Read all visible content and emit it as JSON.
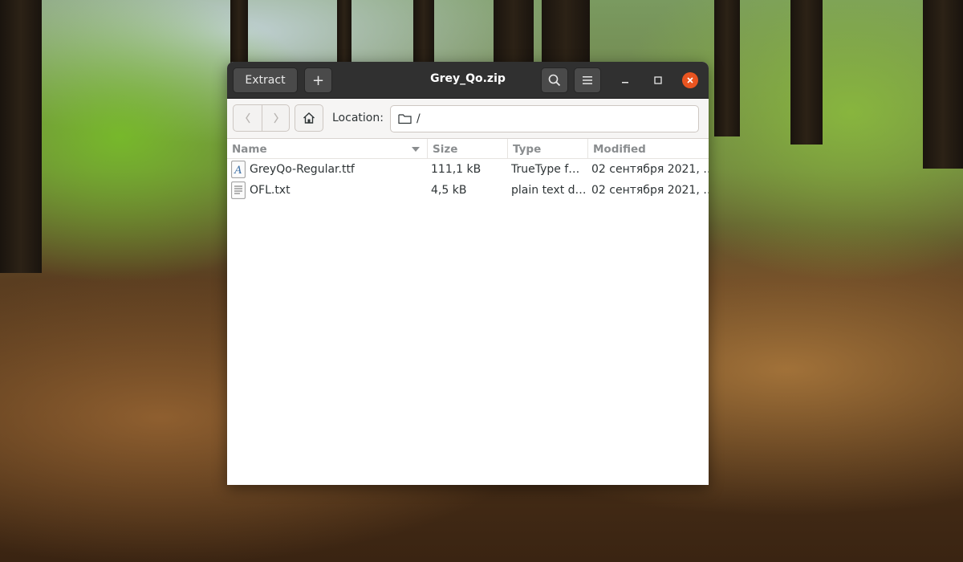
{
  "window": {
    "title": "Grey_Qo.zip",
    "extract_label": "Extract",
    "add_label": "+"
  },
  "toolbar": {
    "location_label": "Location:",
    "location_value": "/"
  },
  "columns": {
    "name": "Name",
    "size": "Size",
    "type": "Type",
    "modified": "Modified"
  },
  "files": [
    {
      "name": "GreyQo-Regular.ttf",
      "size": "111,1 kB",
      "type": "TrueType f…",
      "modified": "02 сентября 2021, …",
      "icon": "font-file-icon"
    },
    {
      "name": "OFL.txt",
      "size": "4,5 kB",
      "type": "plain text d…",
      "modified": "02 сентября 2021, …",
      "icon": "text-file-icon"
    }
  ],
  "colors": {
    "headerbar": "#303030",
    "close_button": "#e95420",
    "window_bg": "#ffffff"
  }
}
